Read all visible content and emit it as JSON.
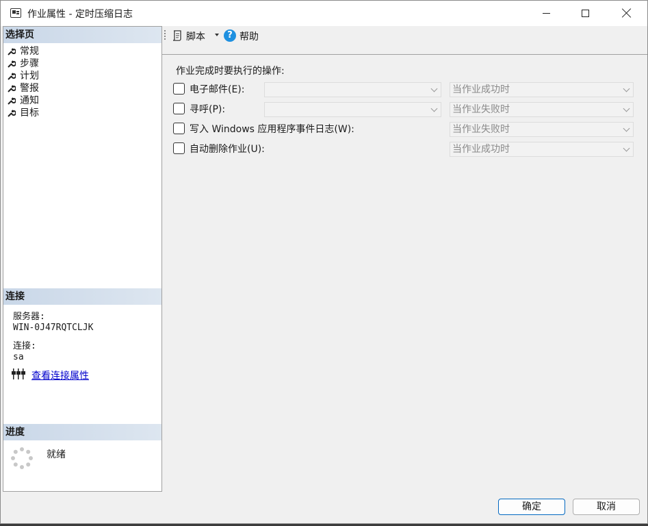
{
  "window": {
    "title": "作业属性 - 定时压缩日志"
  },
  "left_pane": {
    "select_page_header": "选择页",
    "nav_items": [
      {
        "label": "常规"
      },
      {
        "label": "步骤"
      },
      {
        "label": "计划"
      },
      {
        "label": "警报"
      },
      {
        "label": "通知"
      },
      {
        "label": "目标"
      }
    ],
    "connection_header": "连接",
    "server_label": "服务器:",
    "server_value": "WIN-0J47RQTCLJK",
    "connection_label": "连接:",
    "connection_value": "sa",
    "view_connection_link": "查看连接属性",
    "progress_header": "进度",
    "progress_status": "就绪"
  },
  "toolbar": {
    "script_label": "脚本",
    "help_label": "帮助"
  },
  "main": {
    "section_title": "作业完成时要执行的操作:",
    "rows": [
      {
        "label": "电子邮件(E):",
        "checked": false,
        "recipient": "",
        "condition": "当作业成功时"
      },
      {
        "label": "寻呼(P):",
        "checked": false,
        "recipient": "",
        "condition": "当作业失败时"
      },
      {
        "label": "写入 Windows 应用程序事件日志(W):",
        "checked": false,
        "condition": "当作业失败时"
      },
      {
        "label": "自动删除作业(U):",
        "checked": false,
        "condition": "当作业成功时"
      }
    ]
  },
  "buttons": {
    "ok": "确定",
    "cancel": "取消"
  }
}
